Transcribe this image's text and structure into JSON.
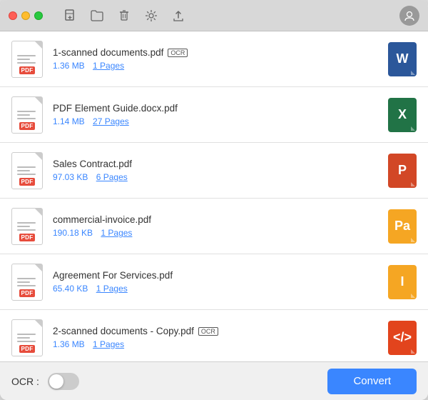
{
  "titlebar": {
    "traffic_lights": [
      "close",
      "minimize",
      "maximize"
    ]
  },
  "files": [
    {
      "name": "1-scanned documents.pdf",
      "has_ocr": true,
      "size": "1.36 MB",
      "pages": "1 Pages",
      "output_type": "word",
      "output_letter": "W"
    },
    {
      "name": "PDF Element Guide.docx.pdf",
      "has_ocr": false,
      "size": "1.14 MB",
      "pages": "27 Pages",
      "output_type": "excel",
      "output_letter": "X"
    },
    {
      "name": "Sales Contract.pdf",
      "has_ocr": false,
      "size": "97.03 KB",
      "pages": "6 Pages",
      "output_type": "ppt",
      "output_letter": "P"
    },
    {
      "name": "commercial-invoice.pdf",
      "has_ocr": false,
      "size": "190.18 KB",
      "pages": "1 Pages",
      "output_type": "pages-app",
      "output_letter": "Pa"
    },
    {
      "name": "Agreement For Services.pdf",
      "has_ocr": false,
      "size": "65.40 KB",
      "pages": "1 Pages",
      "output_type": "indesign",
      "output_letter": "I"
    },
    {
      "name": "2-scanned documents - Copy.pdf",
      "has_ocr": true,
      "size": "1.36 MB",
      "pages": "1 Pages",
      "output_type": "code",
      "output_letter": "</>"
    }
  ],
  "bottom": {
    "ocr_label": "OCR :",
    "convert_label": "Convert"
  }
}
